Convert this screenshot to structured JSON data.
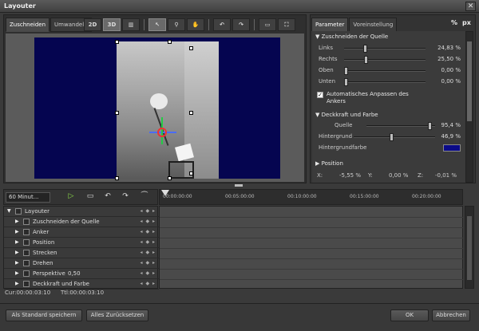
{
  "window": {
    "title": "Layouter",
    "close_glyph": "✕"
  },
  "left_tabs": [
    "Zuschneiden",
    "Umwandeln"
  ],
  "toolbar": {
    "btn_2d": "2D",
    "btn_3d": "3D"
  },
  "parameters": {
    "tabs": [
      "Parameter",
      "Voreinstellung"
    ],
    "unit_percent": "%",
    "unit_px": "px",
    "crop_section": "Zuschneiden der Quelle",
    "crop_rows": [
      {
        "label": "Links",
        "value": "24,83 %",
        "fraction": 0.2483
      },
      {
        "label": "Rechts",
        "value": "25,50 %",
        "fraction": 0.255
      },
      {
        "label": "Oben",
        "value": "0,00 %",
        "fraction": 0.0
      },
      {
        "label": "Unten",
        "value": "0,00 %",
        "fraction": 0.0
      }
    ],
    "auto_anchor_label_1": "Automatisches Anpassen des",
    "auto_anchor_label_2": "Ankers",
    "opacity_section": "Deckkraft und Farbe",
    "source_label": "Quelle",
    "source_value": "95,4 %",
    "source_fraction": 0.954,
    "background_label": "Hintergrund",
    "background_value": "46,9 %",
    "background_fraction": 0.469,
    "bgcolor_label": "Hintergrundfarbe",
    "bgcolor_hex": "#0b0b88",
    "position_section": "Position",
    "pos_x_label": "X:",
    "pos_x_value": "-5,55 %",
    "pos_y_label": "Y:",
    "pos_y_value": "0,00 %",
    "pos_z_label": "Z:",
    "pos_z_value": "-0,01 %"
  },
  "timeline": {
    "zoom_select": "60 Minut...",
    "ruler_ticks": [
      "00:00:00:00",
      "00:05:00:00",
      "00:10:00:00",
      "00:15:00:00",
      "00:20:00:00"
    ],
    "tracks": [
      {
        "name": "Layouter",
        "kf": "◂ ◆ ▸"
      },
      {
        "name": "Zuschneiden der Quelle",
        "kf": "◂ ◆ ▸"
      },
      {
        "name": "Anker",
        "kf": "◂ ◆ ▸"
      },
      {
        "name": "Position",
        "kf": "◂ ◆ ▸"
      },
      {
        "name": "Strecken",
        "kf": "◂ ◆ ▸"
      },
      {
        "name": "Drehen",
        "kf": "◂ ◆ ▸"
      },
      {
        "name": "Perspektive",
        "value": "0,50",
        "kf": "◂ ◆ ▸"
      },
      {
        "name": "Deckkraft und Farbe",
        "kf": "◂ ◆ ▸"
      }
    ],
    "cur_time": "Cur:00:00:03:10",
    "ttl_time": "Ttl:00:00:03:10"
  },
  "buttons": {
    "save_default": "Als Standard speichern",
    "reset_all": "Alles Zurücksetzen",
    "ok": "OK",
    "cancel": "Abbrechen"
  }
}
